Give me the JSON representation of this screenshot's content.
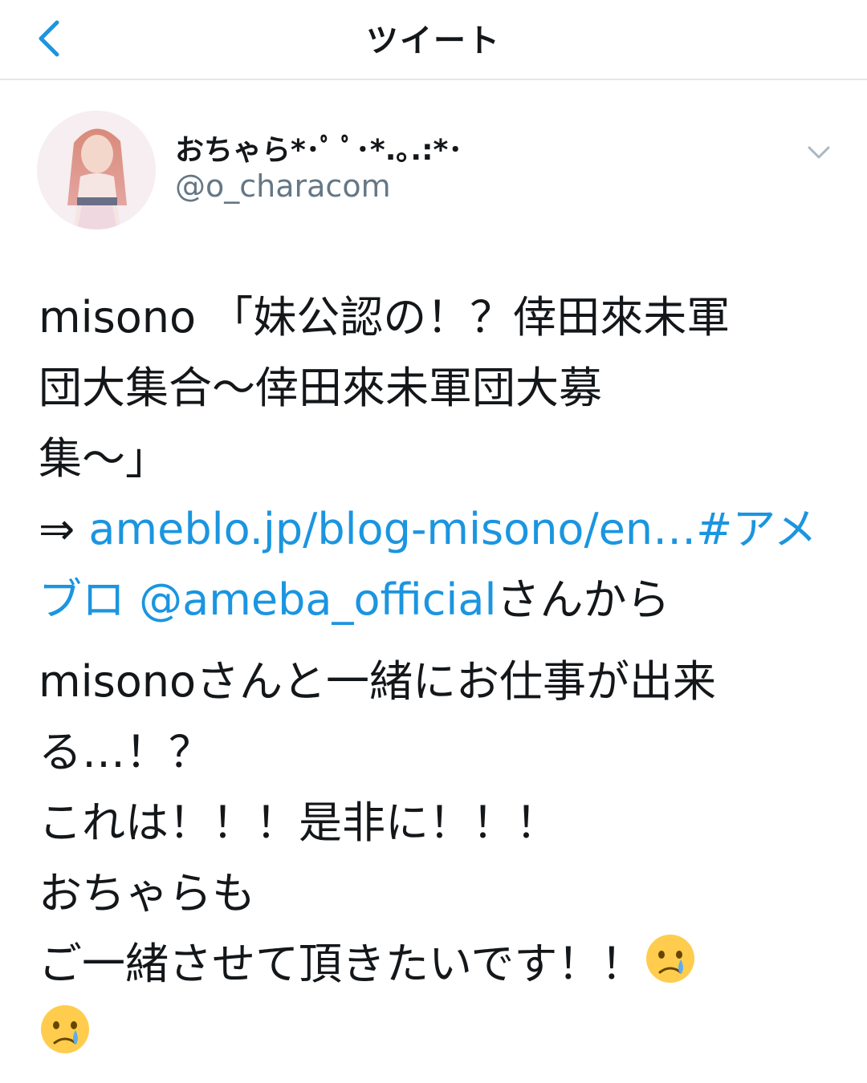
{
  "nav": {
    "title": "ツイート",
    "back_icon": "chevron-left-icon"
  },
  "tweet": {
    "author": {
      "display_name": "おちゃら*･ﾟ ﾟ･*.｡.:*･",
      "handle": "@o_characom"
    },
    "menu_icon": "chevron-down-icon",
    "text": {
      "line1": "misono 「妹公認の！？倖田來未軍",
      "line2": "団大集合～倖田來未軍団大募",
      "line3": "集～」",
      "arrow": " ⇒ ",
      "url": "ameblo.jp/blog-misono/en…",
      "hashtag_a": "#アメ",
      "hashtag_b": "ブロ",
      "mention": "@ameba_official",
      "suffix": "さんから",
      "p2_line1": "misonoさんと一緒にお仕事が出来",
      "p2_line2": "る…！？",
      "p2_line3": "これは！！！是非に！！！",
      "p2_line4": "おちゃらも",
      "p2_line5": "ご一緒させて頂きたいです！！"
    },
    "emoji_icon": "crying-face-icon",
    "colors": {
      "link": "#1b95e0",
      "handle": "#657786",
      "divider": "#e1e8ed"
    }
  }
}
